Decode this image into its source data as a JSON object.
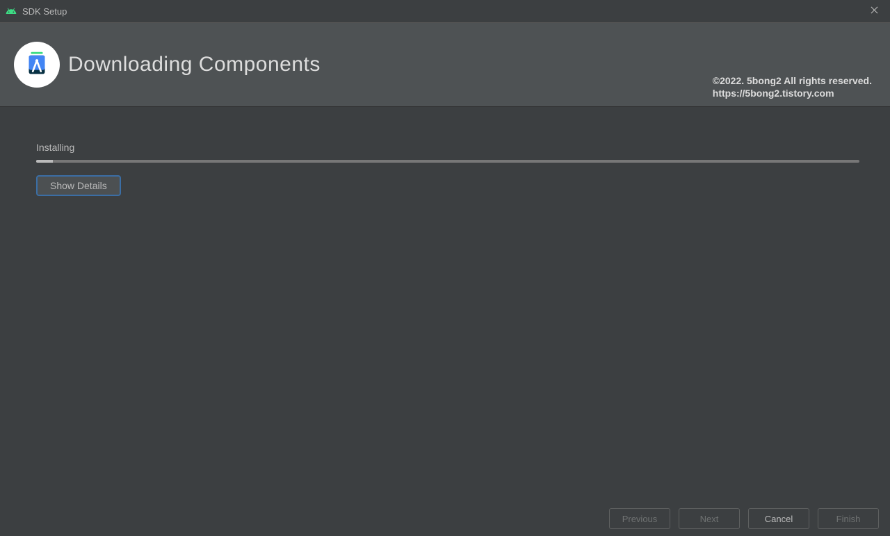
{
  "window": {
    "title": "SDK Setup"
  },
  "header": {
    "title": "Downloading Components",
    "watermark_line1": "©2022. 5bong2 All rights reserved.",
    "watermark_line2": "https://5bong2.tistory.com"
  },
  "content": {
    "status": "Installing",
    "progress_percent": 2,
    "show_details_label": "Show Details"
  },
  "footer": {
    "previous": "Previous",
    "next": "Next",
    "cancel": "Cancel",
    "finish": "Finish"
  }
}
